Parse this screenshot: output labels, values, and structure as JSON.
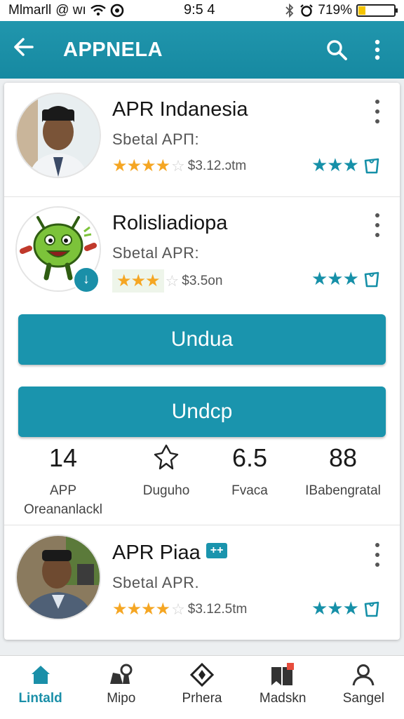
{
  "status_bar": {
    "carrier": "Mlmarll",
    "carrier_icons": "@ wı",
    "time": "9:5 4",
    "battery_text": "719%"
  },
  "app_bar": {
    "title": "APPNELA"
  },
  "apps": [
    {
      "name": "APR Indanesia",
      "subtitle": "Sbetal APΠ:",
      "stars": 3.5,
      "price": "$3.12.ɔtm",
      "badge": ""
    },
    {
      "name": "Rolisliadiopa",
      "subtitle": "Sbetal APR:",
      "stars": 3,
      "price": "$3.5on",
      "badge": ""
    },
    {
      "name": "APR Piaa",
      "subtitle": "Sbetal APR.",
      "stars": 3.5,
      "price": "$3.12.5tm",
      "badge": "++"
    }
  ],
  "buttons": {
    "primary": "Undua",
    "secondary": "Undcp"
  },
  "stats": [
    {
      "value": "14",
      "label_line1": "APP",
      "label_line2": "Oreananlackl"
    },
    {
      "value": "",
      "label_line1": "Duguho",
      "label_line2": ""
    },
    {
      "value": "6.5",
      "label_line1": "Fvaca",
      "label_line2": ""
    },
    {
      "value": "88",
      "label_line1": "IBabengratal",
      "label_line2": ""
    }
  ],
  "bottom_nav": [
    {
      "label": "Lintald",
      "icon": "home-icon",
      "active": true
    },
    {
      "label": "Mipo",
      "icon": "map-icon",
      "active": false
    },
    {
      "label": "Prhera",
      "icon": "diamond-icon",
      "active": false
    },
    {
      "label": "Madskn",
      "icon": "bookmark-icon",
      "active": false
    },
    {
      "label": "Sangel",
      "icon": "person-icon",
      "active": false
    }
  ],
  "colors": {
    "primary": "#1a94ad",
    "star_gold": "#f5a623",
    "star_teal": "#1690a8"
  }
}
